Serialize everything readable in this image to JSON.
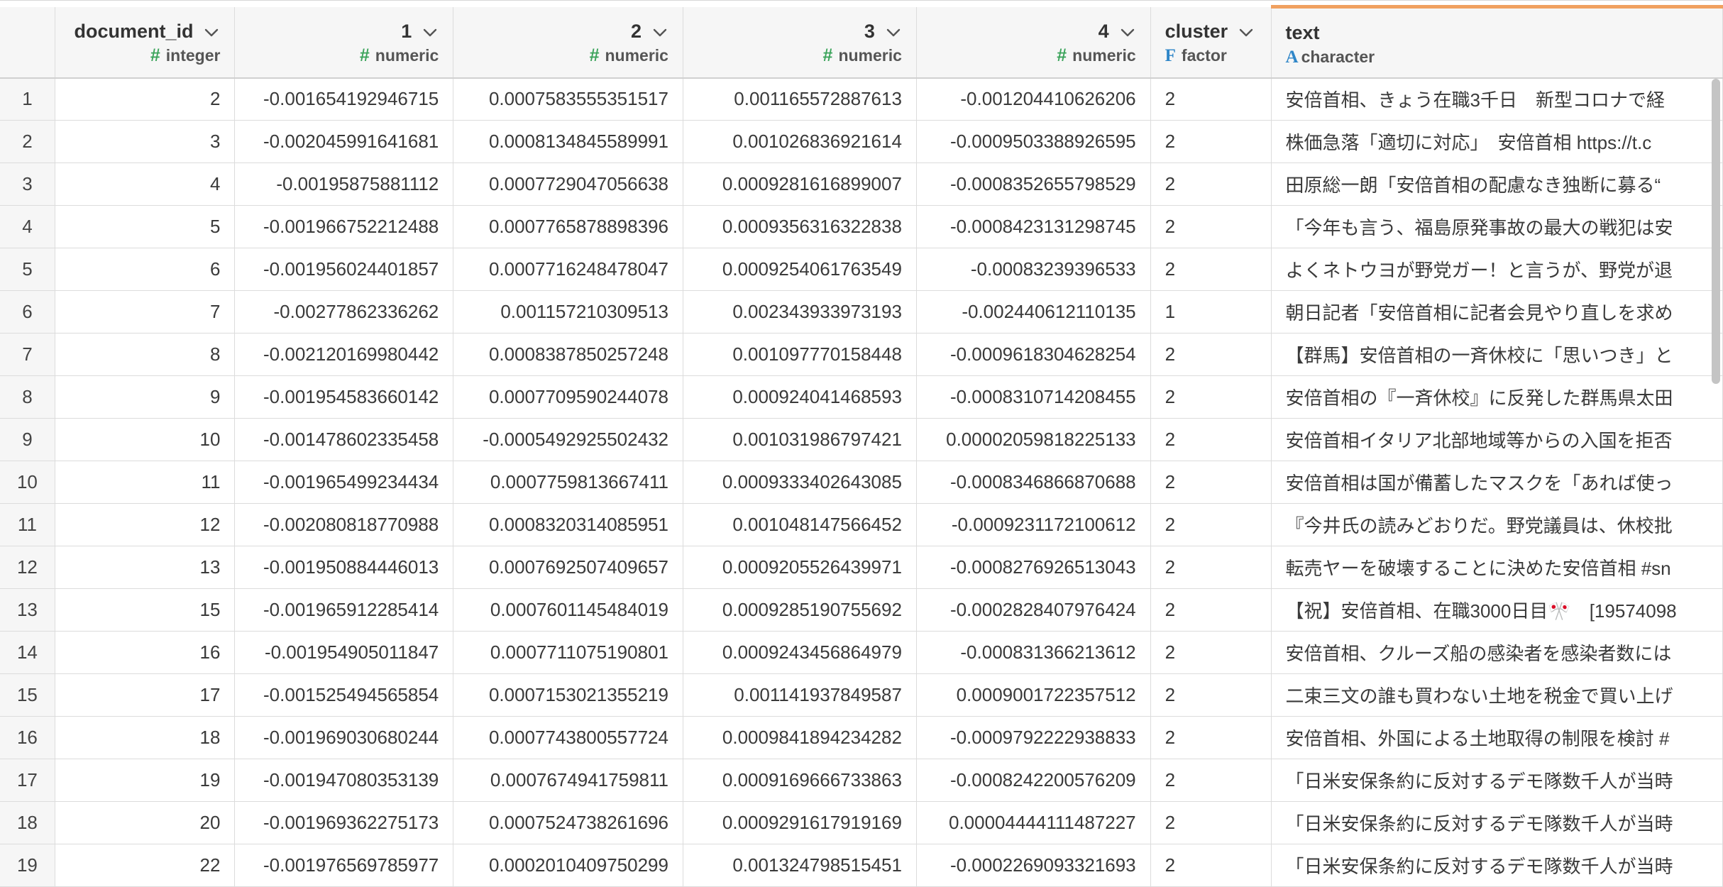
{
  "columns": [
    {
      "key": "rownum",
      "label": "",
      "type_icon": "",
      "type": ""
    },
    {
      "key": "document_id",
      "label": "document_id",
      "type_icon": "#",
      "type": "integer"
    },
    {
      "key": "c1",
      "label": "1",
      "type_icon": "#",
      "type": "numeric"
    },
    {
      "key": "c2",
      "label": "2",
      "type_icon": "#",
      "type": "numeric"
    },
    {
      "key": "c3",
      "label": "3",
      "type_icon": "#",
      "type": "numeric"
    },
    {
      "key": "c4",
      "label": "4",
      "type_icon": "#",
      "type": "numeric"
    },
    {
      "key": "cluster",
      "label": "cluster",
      "type_icon": "F",
      "type": "factor"
    },
    {
      "key": "text",
      "label": "text",
      "type_icon": "A",
      "type": "character"
    }
  ],
  "rows": [
    [
      "1",
      "2",
      "-0.001654192946715",
      "0.0007583555351517",
      "0.001165572887613",
      "-0.001204410626206",
      "2",
      "安倍首相、きょう在職3千日　新型コロナで経"
    ],
    [
      "2",
      "3",
      "-0.002045991641681",
      "0.0008134845589991",
      "0.001026836921614",
      "-0.0009503388926595",
      "2",
      "株価急落「適切に対応」　安倍首相 https://t.c"
    ],
    [
      "3",
      "4",
      "-0.00195875881112",
      "0.0007729047056638",
      "0.0009281616899007",
      "-0.0008352655798529",
      "2",
      "田原総一朗「安倍首相の配慮なき独断に募る“"
    ],
    [
      "4",
      "5",
      "-0.001966752212488",
      "0.0007765878898396",
      "0.0009356316322838",
      "-0.0008423131298745",
      "2",
      "「今年も言う、福島原発事故の最大の戦犯は安"
    ],
    [
      "5",
      "6",
      "-0.001956024401857",
      "0.0007716248478047",
      "0.0009254061763549",
      "-0.00083239396533",
      "2",
      "よくネトウヨが野党ガー！と言うが、野党が退"
    ],
    [
      "6",
      "7",
      "-0.00277862336262",
      "0.001157210309513",
      "0.002343933973193",
      "-0.002440612110135",
      "1",
      "朝日記者「安倍首相に記者会見やり直しを求め"
    ],
    [
      "7",
      "8",
      "-0.002120169980442",
      "0.0008387850257248",
      "0.001097770158448",
      "-0.0009618304628254",
      "2",
      "【群馬】安倍首相の一斉休校に「思いつき」と"
    ],
    [
      "8",
      "9",
      "-0.001954583660142",
      "0.0007709590244078",
      "0.000924041468593",
      "-0.0008310714208455",
      "2",
      "安倍首相の『一斉休校』に反発した群馬県太田"
    ],
    [
      "9",
      "10",
      "-0.001478602335458",
      "-0.0005492925502432",
      "0.001031986797421",
      "0.00002059818225133",
      "2",
      "安倍首相イタリア北部地域等からの入国を拒否"
    ],
    [
      "10",
      "11",
      "-0.001965499234434",
      "0.0007759813667411",
      "0.0009333402643085",
      "-0.0008346866870688",
      "2",
      "安倍首相は国が備蓄したマスクを「あれば使っ"
    ],
    [
      "11",
      "12",
      "-0.002080818770988",
      "0.0008320314085951",
      "0.001048147566452",
      "-0.0009231172100612",
      "2",
      "『今井氏の読みどおりだ。野党議員は、休校批"
    ],
    [
      "12",
      "13",
      "-0.001950884446013",
      "0.0007692507409657",
      "0.0009205526439971",
      "-0.0008276926513043",
      "2",
      "転売ヤーを破壊することに決めた安倍首相 #sn"
    ],
    [
      "13",
      "15",
      "-0.001965912285414",
      "0.0007601145484019",
      "0.0009285190755692",
      "-0.0002828407976424",
      "2",
      "【祝】安倍首相、在職3000日目🎌　[19574098"
    ],
    [
      "14",
      "16",
      "-0.001954905011847",
      "0.0007711075190801",
      "0.0009243456864979",
      "-0.000831366213612",
      "2",
      "安倍首相、クルーズ船の感染者を感染者数には"
    ],
    [
      "15",
      "17",
      "-0.001525494565854",
      "0.0007153021355219",
      "0.001141937849587",
      "0.0009001722357512",
      "2",
      "二束三文の誰も買わない土地を税金で買い上げ"
    ],
    [
      "16",
      "18",
      "-0.001969030680244",
      "0.0007743800557724",
      "0.0009841894234282",
      "-0.0009792222938833",
      "2",
      "安倍首相、外国による土地取得の制限を検討 #"
    ],
    [
      "17",
      "19",
      "-0.001947080353139",
      "0.0007674941759811",
      "0.0009169666733863",
      "-0.0008242200576209",
      "2",
      "「日米安保条約に反対するデモ隊数千人が当時"
    ],
    [
      "18",
      "20",
      "-0.001969362275173",
      "0.0007524738261696",
      "0.0009291617919169",
      "0.00004444111487227",
      "2",
      "「日米安保条約に反対するデモ隊数千人が当時"
    ],
    [
      "19",
      "22",
      "-0.001976569785977",
      "0.0002010409750299",
      "0.001324798515451",
      "-0.0002269093321693",
      "2",
      "「日米安保条約に反対するデモ隊数千人が当時"
    ]
  ]
}
